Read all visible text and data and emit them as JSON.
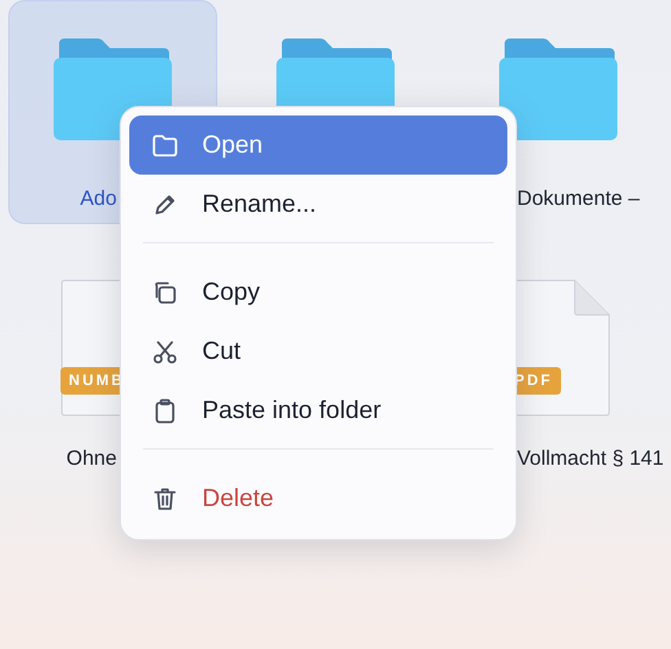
{
  "grid": [
    {
      "kind": "folder",
      "label": "Ado",
      "selected": true
    },
    {
      "kind": "folder",
      "selected": false
    },
    {
      "kind": "folder",
      "label": "Dokumente –",
      "selected": false
    },
    {
      "kind": "document",
      "label": "Ohne",
      "badge": "NUMB",
      "selected": false
    },
    {
      "kind": "hidden"
    },
    {
      "kind": "document",
      "label": "Vollmacht § 141",
      "badge": "PDF",
      "selected": false
    }
  ],
  "context_menu": {
    "items": [
      {
        "kind": "open",
        "label": "Open",
        "selected": true
      },
      {
        "kind": "rename",
        "label": "Rename...",
        "selected": false
      },
      {
        "kind": "separator"
      },
      {
        "kind": "copy",
        "label": "Copy",
        "selected": false
      },
      {
        "kind": "cut",
        "label": "Cut",
        "selected": false
      },
      {
        "kind": "paste",
        "label": "Paste into folder",
        "selected": false
      },
      {
        "kind": "separator"
      },
      {
        "kind": "delete",
        "label": "Delete",
        "selected": false
      }
    ]
  }
}
